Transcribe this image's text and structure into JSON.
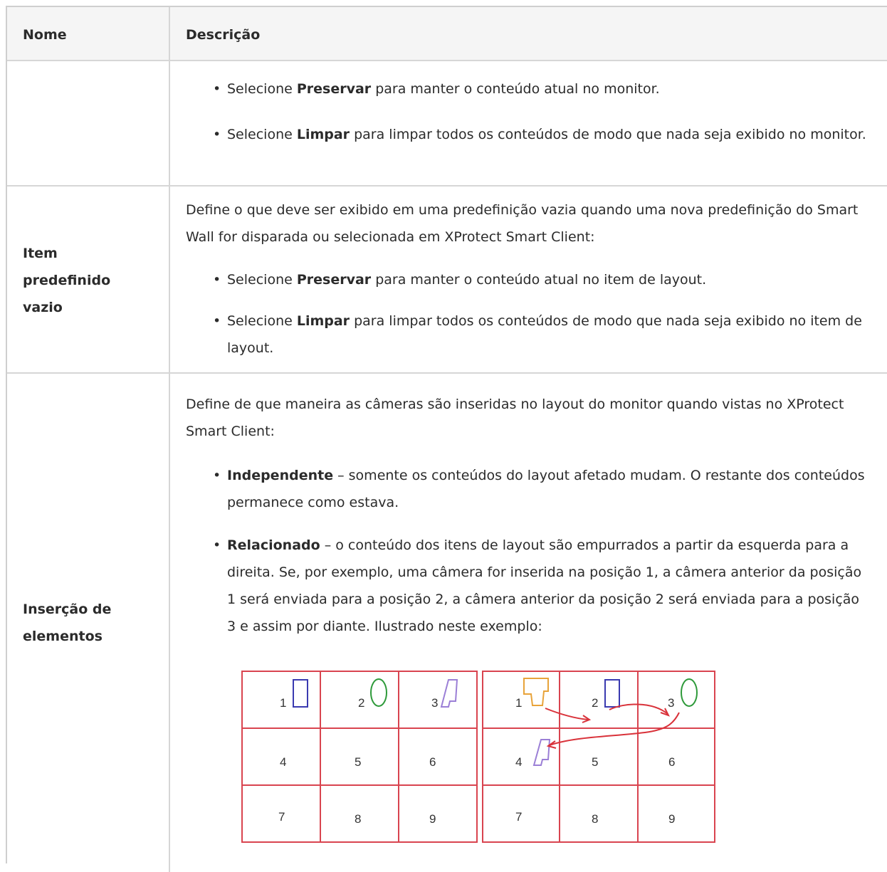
{
  "header": {
    "name": "Nome",
    "description": "Descrição"
  },
  "row1": {
    "bullets": [
      {
        "pre": "Selecione ",
        "bold": "Preservar",
        "post": " para manter o conteúdo atual no monitor."
      },
      {
        "pre": "Selecione ",
        "bold": "Limpar",
        "post": " para limpar todos os conteúdos de modo que nada seja exibido no monitor."
      }
    ]
  },
  "row2": {
    "name_lines": [
      "Item",
      "predefinido",
      "vazio"
    ],
    "intro": "Define o que deve ser exibido em uma predefinição vazia quando uma nova predefinição do Smart Wall for disparada ou selecionada em XProtect Smart Client:",
    "bullets": [
      {
        "pre": "Selecione ",
        "bold": "Preservar",
        "post": " para manter o conteúdo atual no item de layout."
      },
      {
        "pre": "Selecione ",
        "bold": "Limpar",
        "post": " para limpar todos os conteúdos de modo que nada seja exibido no item de layout."
      }
    ]
  },
  "row3": {
    "name_lines": [
      "Inserção de",
      "elementos"
    ],
    "intro": "Define de que maneira as câmeras são inseridas no layout do monitor quando vistas no XProtect Smart Client:",
    "bullets": [
      {
        "pre": "",
        "bold": "Independente",
        "post": " – somente os conteúdos do layout afetado mudam. O restante dos conteúdos permanece como estava."
      },
      {
        "pre": " ",
        "bold": "Relacionado",
        "post": " – o conteúdo dos itens de layout são empurrados a partir da esquerda para a direita. Se, por exemplo, uma câmera for inserida na posição 1, a câmera anterior da posição 1 será enviada para a posição 2, a câmera anterior da posição 2 será enviada para a posição 3 e assim por diante. Ilustrado neste exemplo:"
      }
    ]
  },
  "diagram": {
    "left_grid": [
      "1",
      "2",
      "3",
      "4",
      "5",
      "6",
      "7",
      "8",
      "9"
    ],
    "right_grid": [
      "1",
      "2",
      "3",
      "4",
      "5",
      "6",
      "7",
      "8",
      "9"
    ],
    "colors": {
      "grid": "#d9444f",
      "blue": "#3a3ab0",
      "green": "#2e9a3a",
      "purple": "#9b7fd6",
      "orange": "#e8a33a",
      "arrow": "#d9323a"
    }
  }
}
